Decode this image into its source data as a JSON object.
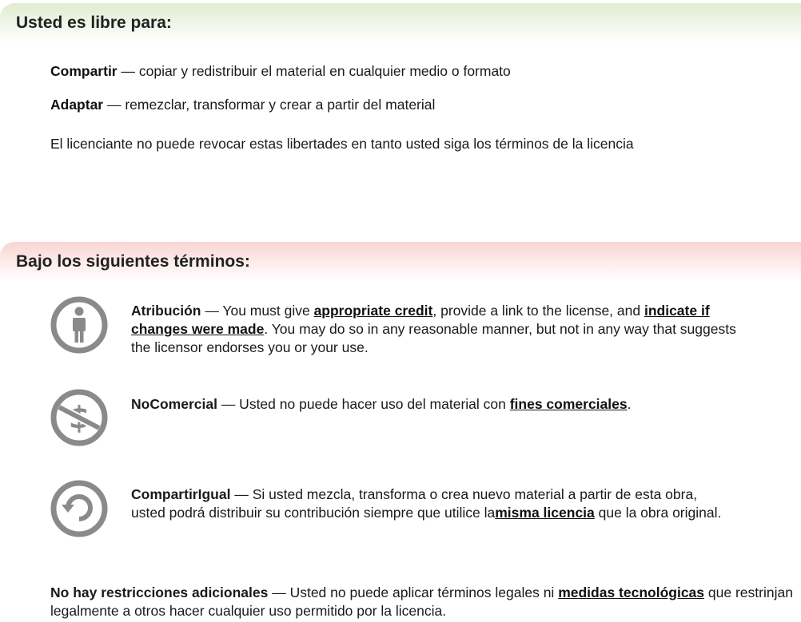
{
  "free_section": {
    "title": "Usted es libre para:",
    "share": {
      "label": "Compartir",
      "text": " — copiar y redistribuir el material en cualquier medio o formato"
    },
    "adapt": {
      "label": "Adaptar",
      "text": " — remezclar, transformar y crear a partir del material"
    },
    "note": "El licenciante no puede revocar estas libertades en tanto usted siga los términos de la licencia"
  },
  "terms_section": {
    "title": "Bajo los siguientes términos:",
    "attribution": {
      "icon": "attribution-person-icon",
      "label": "Atribución",
      "text1": " — You must give ",
      "link1": "appropriate credit",
      "text2": ", provide a link to the license, and ",
      "link2": "indicate if changes were made",
      "text3": ". You may do so in any reasonable manner, but not in any way that suggests the licensor endorses you or your use."
    },
    "noncommercial": {
      "icon": "non-commercial-dollar-icon",
      "label": "NoComercial",
      "text1": " — Usted no puede hacer uso del material con ",
      "link1": "fines comerciales",
      "text2": "."
    },
    "sharealike": {
      "icon": "share-alike-icon",
      "label": "CompartirIgual",
      "text1": " — Si usted mezcla, transforma o crea nuevo material a partir de esta obra, usted podrá distribuir su contribución siempre que utilice la",
      "link1": "misma licencia",
      "text2": " que la obra original."
    }
  },
  "no_restrictions": {
    "label": "No hay restricciones adicionales",
    "text1": " — Usted no puede aplicar términos legales ni ",
    "link1": "medidas tecnológicas",
    "text2": " que restrinjan legalmente a otros hacer cualquier uso permitido por la licencia."
  },
  "colors": {
    "free_header": "#dfecd0",
    "terms_header": "#f8d5d2",
    "icon_gray": "#8a8a8a"
  }
}
